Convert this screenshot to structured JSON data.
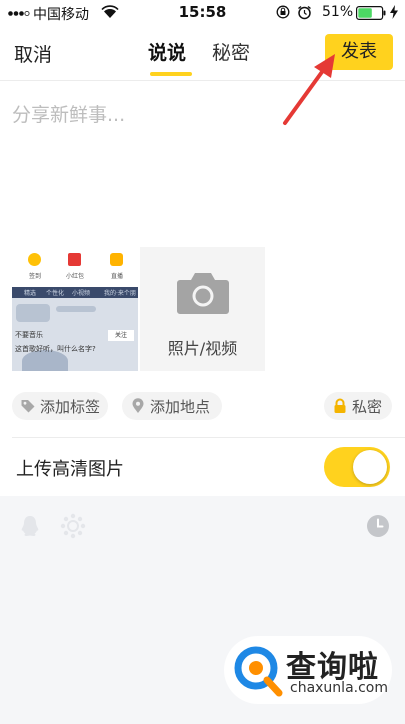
{
  "status_bar": {
    "carrier": "中国移动",
    "time": "15:58",
    "battery_percent": "51%"
  },
  "header": {
    "cancel_label": "取消",
    "tabs": [
      {
        "label": "说说",
        "active": true
      },
      {
        "label": "秘密",
        "active": false
      }
    ],
    "publish_label": "发表"
  },
  "compose": {
    "placeholder": "分享新鲜事..."
  },
  "media": {
    "thumbnail": {
      "icon_labels": [
        "签到",
        "小红包",
        "直播"
      ],
      "nav_items": [
        "精选",
        "个性化",
        "小视频"
      ],
      "side_text": "我的·来个朋友",
      "line1": "不要音乐",
      "line2": "这首歌好听，叫什么名字?",
      "button": "关注"
    },
    "photo_video_label": "照片/视频"
  },
  "chips": {
    "tag_label": "添加标签",
    "location_label": "添加地点",
    "private_label": "私密"
  },
  "upload_hd": {
    "label": "上传高清图片",
    "enabled": true
  },
  "watermark": {
    "title": "查询啦",
    "subtitle": "chaxunla.com"
  },
  "colors": {
    "accent": "#ffd21e",
    "annotation": "#e53935",
    "watermark_blue": "#1e88e5",
    "watermark_orange": "#ff8f00"
  }
}
